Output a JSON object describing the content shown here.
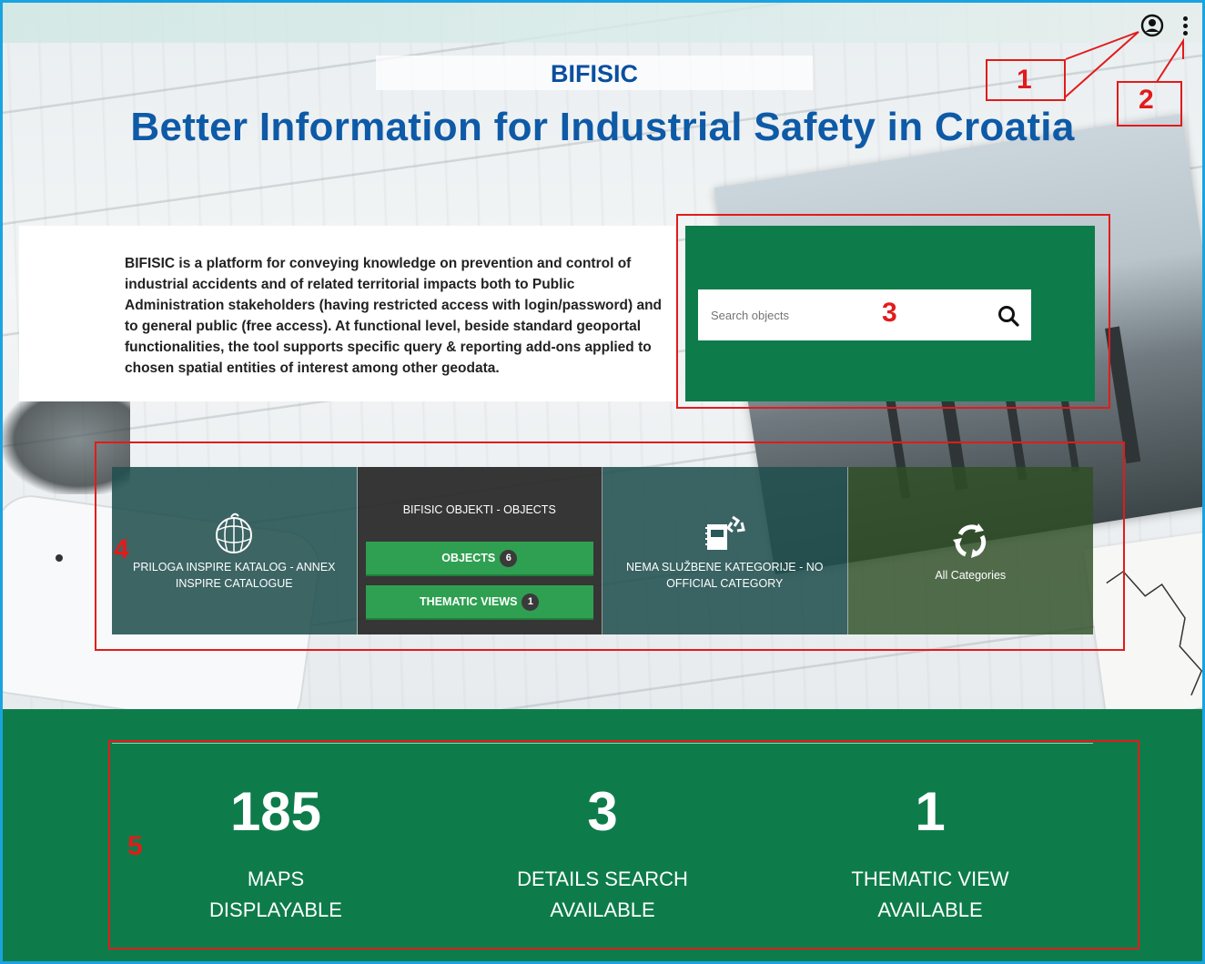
{
  "header": {
    "site_name": "BIFISIC",
    "site_title": "Better Information for Industrial Safety in Croatia",
    "user_icon": "user-circle-icon",
    "menu_icon": "kebab-menu-icon"
  },
  "intro": {
    "text": "BIFISIC is a platform for conveying knowledge on prevention and control of industrial accidents and of related territorial impacts both to Public Administration stakeholders (having restricted access with login/password) and to general public (free access). At functional level, beside standard geoportal functionalities, the tool supports specific query & reporting add-ons applied to chosen spatial entities of interest among other geodata."
  },
  "search": {
    "placeholder": "Search objects",
    "button_icon": "search-icon"
  },
  "categories": [
    {
      "label": "PRILOGA INSPIRE KATALOG - ANNEX INSPIRE CATALOGUE",
      "icon": "globe-grid-icon"
    },
    {
      "title": "BIFISIC OBJEKTI - OBJECTS",
      "objects_label": "OBJECTS",
      "objects_count": "6",
      "views_label": "THEMATIC VIEWS",
      "views_count": "1"
    },
    {
      "label": "NEMA SLUŽBENE KATEGORIJE - NO OFFICIAL CATEGORY",
      "icon": "notebook-recycle-icon"
    },
    {
      "label": "All Categories",
      "icon": "recycle-arrows-icon"
    }
  ],
  "stats": [
    {
      "value": "185",
      "line1": "MAPS",
      "line2": "DISPLAYABLE"
    },
    {
      "value": "3",
      "line1": "DETAILS SEARCH",
      "line2": "AVAILABLE"
    },
    {
      "value": "1",
      "line1": "THEMATIC VIEW",
      "line2": "AVAILABLE"
    }
  ],
  "callouts": [
    "1",
    "2",
    "3",
    "4",
    "5"
  ],
  "colors": {
    "brand_green": "#0d7c4a",
    "title_blue": "#0e5aa7",
    "callout_red": "#e21b1b",
    "frame_blue": "#1aa3e0"
  }
}
